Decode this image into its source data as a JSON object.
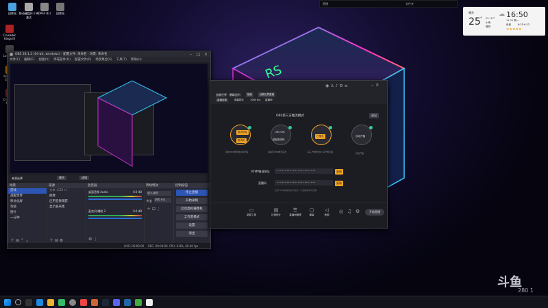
{
  "desktop": {
    "icons": [
      {
        "label": "回收站"
      },
      {
        "label": "移动硬盘(E:) 待激活"
      },
      {
        "label": "DATA (E:)"
      },
      {
        "label": "回收站"
      },
      {
        "label": "Crusader Kings III"
      },
      {
        "label": "Launcher"
      },
      {
        "label": "Rockstar Games"
      },
      {
        "label": "Crusader Kings"
      }
    ],
    "top_bar": {
      "left": "直播",
      "mid": "文件夹",
      "right": "文件夹"
    },
    "watermark": {
      "brand": "斗鱼",
      "id": "280 1"
    }
  },
  "weather_widget": {
    "city": "晴天",
    "temperature": "25",
    "unit": "°",
    "hi_lo": "22~27°",
    "condition": "小雨",
    "rain": "微风",
    "time": "16:50",
    "date": "11-21 周一",
    "aqi_label": "优良",
    "aqi_range": "6:25-6:22",
    "stars": "★★★★★"
  },
  "obs": {
    "title": "OBS 28.1.2 (64-bit, windows) - 配置文件: 未命名 - 场景: 未命名",
    "menu": [
      "文件(F)",
      "编辑(E)",
      "视图(V)",
      "停靠部件(D)",
      "配置文件(P)",
      "场景集合(S)",
      "工具(T)",
      "帮助(H)"
    ],
    "toolbar_label": "来源选择",
    "props_button": "属性",
    "filter_button": "滤镜",
    "panels": {
      "scenes": {
        "title": "场景",
        "items": [
          "游戏",
          "战舰世界",
          "移动化屏",
          "等级",
          "图片",
          "一分钟"
        ]
      },
      "sources": {
        "title": "来源",
        "items": [
          "文本 (GDI+)",
          "图像",
          "应用音频捕获",
          "显示器采集"
        ]
      },
      "mixer": {
        "title": "混音器",
        "tracks": [
          {
            "name": "桌面音频 Audio",
            "db": "0.0 dB"
          },
          {
            "name": "麦克风/辅助 2",
            "db": "0.0 dB"
          }
        ]
      },
      "transitions": {
        "title": "转场特效",
        "type": "淡入淡出",
        "duration_label": "时长",
        "duration": "300 ms"
      },
      "controls": {
        "title": "控制按钮",
        "buttons": [
          "停止直播",
          "开始录制",
          "启动虚拟摄像机",
          "工作室模式",
          "设置",
          "退出"
        ]
      }
    },
    "status": {
      "live": "LIVE: 00:00:00",
      "rec": "REC: 00:00:00",
      "cpu": "CPU: 0.8%, 60.00 fps"
    }
  },
  "douyu": {
    "header": {
      "title": "战舰世界 · 暴躁战列",
      "tag1": "舰船",
      "tag2": "战舰世界直播",
      "sub1": "直播设置",
      "sub2": "弹幕助手",
      "sub3": "1080 fps",
      "sub4": "直播间"
    },
    "mode_title": "OBS第三方推流模式",
    "mode_link": "退出",
    "steps": [
      {
        "btn1": "推流地址",
        "btn2": "推流码",
        "caption": "复制OBS推流地址和密码"
      },
      {
        "btn1": "OBS URL",
        "btn2": "粘贴推流码",
        "caption": "粘贴至OBS推流设置"
      },
      {
        "btn1": "已推流",
        "caption": "第三方推流成功 请开始直播"
      },
      {
        "btn1": "自动开播",
        "caption": "自动开播"
      }
    ],
    "fields": [
      {
        "label": "RTMP推流地址",
        "value": "••••••••••••••••••••••••",
        "action": "复制"
      },
      {
        "label": "直播码",
        "value": "••••••••••••••••••••••••",
        "action": "复制"
      }
    ],
    "hint": "注意:OBS推流地址中包含个人直播码请勿泄露",
    "tools": [
      "录屏工具",
      "礼物统计",
      "直播间管理",
      "弹幕",
      "音频",
      "摄像头"
    ],
    "start_button": "开始直播"
  }
}
